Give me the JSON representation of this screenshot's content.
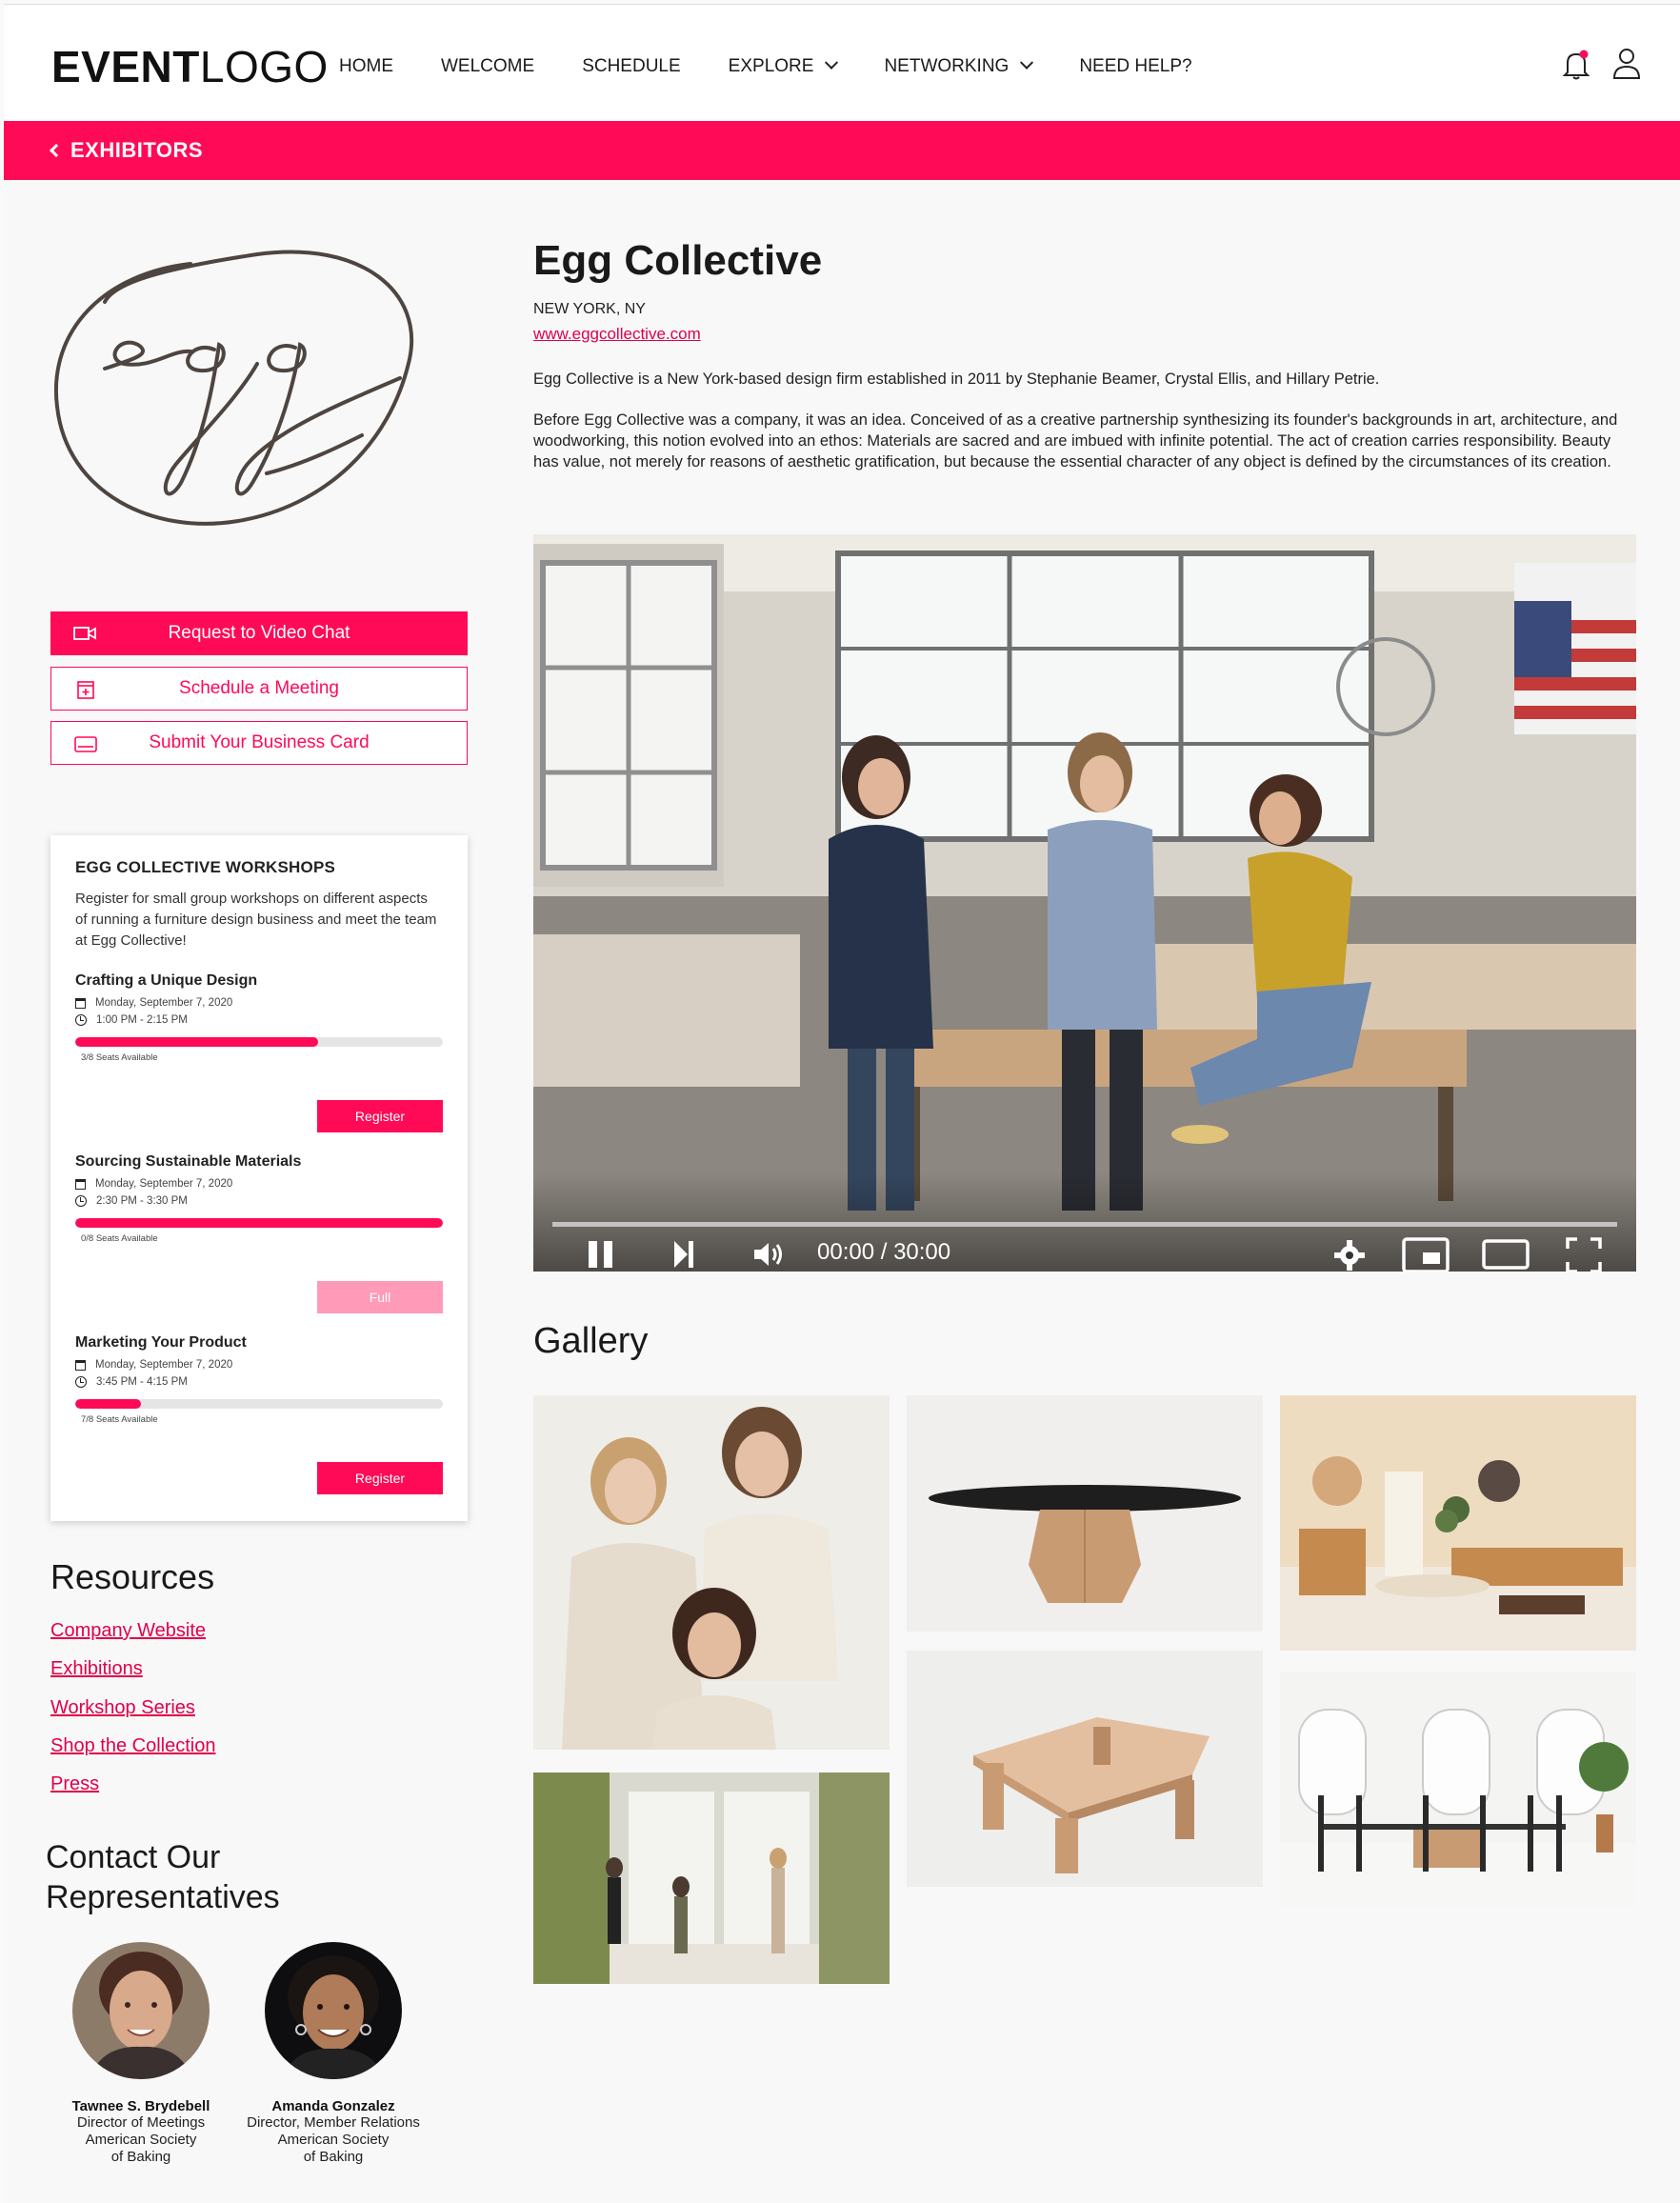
{
  "header": {
    "logo_bold": "EVENT",
    "logo_light": "LOGO",
    "nav": [
      "HOME",
      "WELCOME",
      "SCHEDULE",
      "EXPLORE",
      "NETWORKING",
      "NEED HELP?"
    ]
  },
  "banner": {
    "back_label": "EXHIBITORS"
  },
  "exhibitor": {
    "name": "Egg Collective",
    "location": "NEW YORK, NY",
    "website": "www.eggcollective.com",
    "intro": "Egg Collective is a New York-based design firm established in 2011 by Stephanie Beamer, Crystal Ellis, and Hillary Petrie.",
    "about": "Before Egg Collective was a company, it was an idea. Conceived of  as a creative partnership synthesizing its founder's backgrounds in art, architecture, and woodworking, this notion evolved into an ethos: Materials are sacred and are imbued with infinite potential.  The act of creation carries responsibility. Beauty has value, not merely for reasons of aesthetic gratification, but because the essential character of any object is defined by the circumstances of its creation."
  },
  "actions": {
    "video_chat": "Request to Video Chat",
    "schedule": "Schedule a Meeting",
    "business_card": "Submit Your Business Card"
  },
  "workshops": {
    "title": "EGG COLLECTIVE WORKSHOPS",
    "description": "Register for small group workshops on different aspects of running a furniture design business and meet the team at Egg Collective!",
    "sessions": [
      {
        "name": "Crafting a Unique Design",
        "date": "Monday, September 7, 2020",
        "time": "1:00 PM - 2:15 PM",
        "seats": "3/8 Seats Available",
        "fill": 0.66,
        "button": "Register",
        "full": false
      },
      {
        "name": "Sourcing Sustainable Materials",
        "date": "Monday, September 7, 2020",
        "time": "2:30 PM - 3:30 PM",
        "seats": "0/8 Seats Available",
        "fill": 1.0,
        "button": "Full",
        "full": true
      },
      {
        "name": "Marketing Your Product",
        "date": "Monday, September 7, 2020",
        "time": "3:45 PM - 4:15 PM",
        "seats": "7/8 Seats Available",
        "fill": 0.18,
        "button": "Register",
        "full": false
      }
    ]
  },
  "resources": {
    "title": "Resources",
    "links": [
      "Company Website",
      "Exhibitions",
      "Workshop Series",
      "Shop the Collection",
      "Press"
    ]
  },
  "contact": {
    "title": "Contact Our Representatives",
    "reps": [
      {
        "name": "Tawnee S. Brydebell",
        "role": "Director of Meetings",
        "org1": "American Society",
        "org2": "of Baking"
      },
      {
        "name": "Amanda Gonzalez",
        "role": "Director, Member Relations",
        "org1": "American Society",
        "org2": "of Baking"
      }
    ]
  },
  "video": {
    "time": "00:00 / 30:00",
    "progress": 0.0
  },
  "gallery": {
    "title": "Gallery"
  },
  "colors": {
    "accent": "#ff0a56"
  }
}
